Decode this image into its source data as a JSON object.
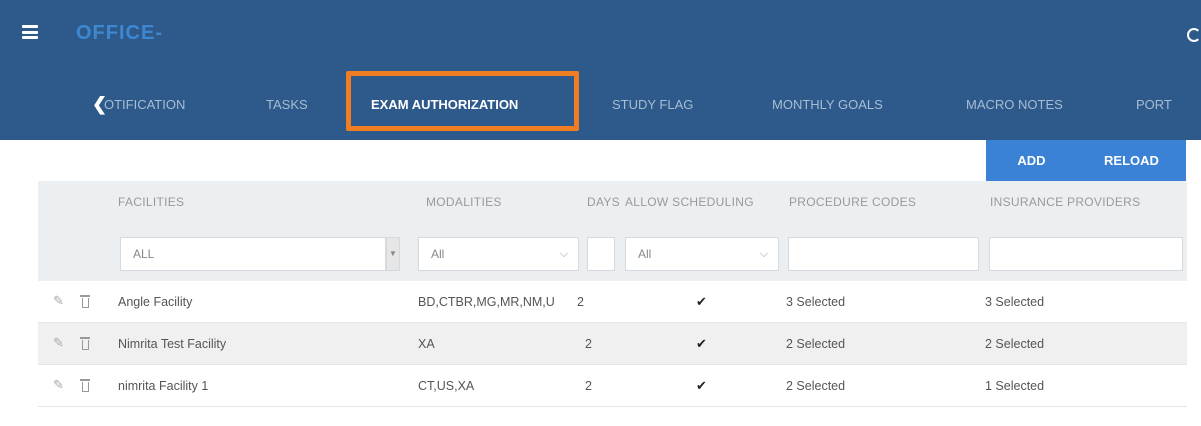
{
  "header": {
    "app_title": "OFFICE-",
    "menu_icon": "hamburger-icon",
    "refresh_icon": "refresh-icon"
  },
  "tabs": [
    {
      "label": "OTIFICATION"
    },
    {
      "label": "TASKS"
    },
    {
      "label": "EXAM AUTHORIZATION"
    },
    {
      "label": "STUDY FLAG"
    },
    {
      "label": "MONTHLY GOALS"
    },
    {
      "label": "MACRO NOTES"
    },
    {
      "label": "PORT"
    }
  ],
  "toolbar": {
    "add_label": "ADD",
    "reload_label": "RELOAD"
  },
  "columns": {
    "facilities": "FACILITIES",
    "modalities": "MODALITIES",
    "days": "DAYS",
    "allow_scheduling": "ALLOW SCHEDULING",
    "procedure_codes": "PROCEDURE CODES",
    "insurance_providers": "INSURANCE PROVIDERS"
  },
  "filters": {
    "facilities": "ALL",
    "modalities": "All",
    "days": "",
    "allow_scheduling": "All",
    "procedure_codes": "",
    "insurance_providers": ""
  },
  "rows": [
    {
      "facility": "Angle Facility",
      "modalities": "BD,CTBR,MG,MR,NM,U",
      "days": "2",
      "allow": "✔",
      "procedures": "3 Selected",
      "insurance": "3 Selected"
    },
    {
      "facility": "Nimrita Test Facility",
      "modalities": "XA",
      "days": "2",
      "allow": "✔",
      "procedures": "2 Selected",
      "insurance": "2 Selected"
    },
    {
      "facility": "nimrita Facility 1",
      "modalities": "CT,US,XA",
      "days": "2",
      "allow": "✔",
      "procedures": "2 Selected",
      "insurance": "1 Selected"
    }
  ],
  "colors": {
    "header_bg": "#2d5a8a",
    "accent": "#3b82d6",
    "highlight": "#f07d22"
  }
}
